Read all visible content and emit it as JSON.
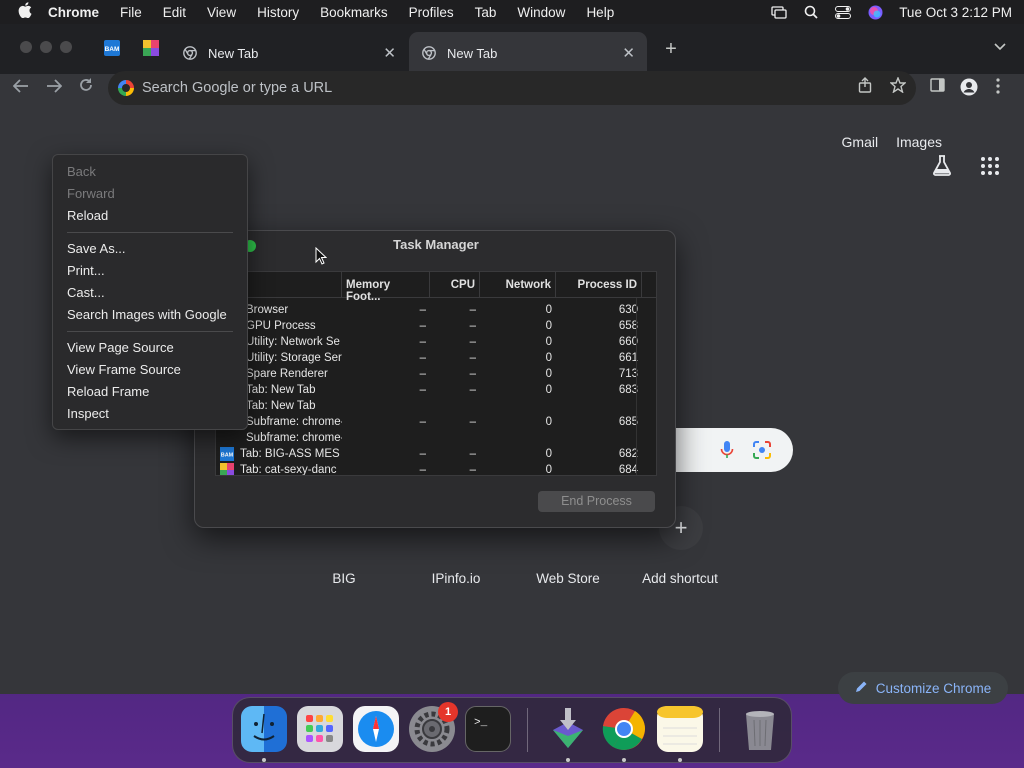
{
  "menubar": {
    "app_name": "Chrome",
    "items": [
      "File",
      "Edit",
      "View",
      "History",
      "Bookmarks",
      "Profiles",
      "Tab",
      "Window",
      "Help"
    ],
    "datetime": "Tue Oct 3  2:12 PM"
  },
  "tabs": {
    "pinned": [
      {
        "icon": "bam-favicon-icon",
        "label": "BAM"
      },
      {
        "icon": "colorful-favicon-icon"
      }
    ],
    "open": [
      {
        "title": "New Tab",
        "active": false
      },
      {
        "title": "New Tab",
        "active": true
      }
    ]
  },
  "omnibox": {
    "placeholder": "Search Google or type a URL"
  },
  "ntp": {
    "gmail": "Gmail",
    "images": "Images",
    "shortcuts": [
      "BIG",
      "IPinfo.io",
      "Web Store",
      "Add shortcut"
    ],
    "customize": "Customize Chrome"
  },
  "task_manager": {
    "title": "Task Manager",
    "columns": [
      "Memory Foot...",
      "CPU",
      "Network",
      "Process ID"
    ],
    "rows": [
      {
        "task": "Browser",
        "mem": "–",
        "cpu": "–",
        "net": "0",
        "pid": "630"
      },
      {
        "task": "GPU Process",
        "mem": "–",
        "cpu": "–",
        "net": "0",
        "pid": "658"
      },
      {
        "task": "Utility: Network Se",
        "mem": "–",
        "cpu": "–",
        "net": "0",
        "pid": "660"
      },
      {
        "task": "Utility: Storage Ser",
        "mem": "–",
        "cpu": "–",
        "net": "0",
        "pid": "661"
      },
      {
        "task": "Spare Renderer",
        "mem": "–",
        "cpu": "–",
        "net": "0",
        "pid": "713"
      },
      {
        "task": "Tab: New Tab",
        "mem": "–",
        "cpu": "–",
        "net": "0",
        "pid": "683"
      },
      {
        "task": "Tab: New Tab",
        "mem": "",
        "cpu": "",
        "net": "",
        "pid": ""
      },
      {
        "task": "Subframe: chrome-",
        "mem": "–",
        "cpu": "–",
        "net": "0",
        "pid": "685"
      },
      {
        "task": "Subframe: chrome-",
        "mem": "",
        "cpu": "",
        "net": "",
        "pid": ""
      },
      {
        "task": "Tab: BIG-ASS MES",
        "mem": "–",
        "cpu": "–",
        "net": "0",
        "pid": "682",
        "icon": "bam"
      },
      {
        "task": "Tab: cat-sexy-danc",
        "mem": "–",
        "cpu": "–",
        "net": "0",
        "pid": "684",
        "icon": "colorful"
      }
    ],
    "end_process": "End Process"
  },
  "context_menu": {
    "back": "Back",
    "forward": "Forward",
    "reload": "Reload",
    "save_as": "Save As...",
    "print": "Print...",
    "cast": "Cast...",
    "search_images": "Search Images with Google",
    "view_page_source": "View Page Source",
    "view_frame_source": "View Frame Source",
    "reload_frame": "Reload Frame",
    "inspect": "Inspect"
  },
  "dock": {
    "apps": [
      "Finder",
      "Launchpad",
      "Safari",
      "System Settings",
      "Terminal",
      "Installer",
      "Chrome",
      "Notes",
      "Trash"
    ],
    "settings_badge": "1"
  },
  "colors": {
    "accent_link": "#8ab4f8",
    "window_bg": "#35363a",
    "tabstrip_bg": "#202124"
  }
}
